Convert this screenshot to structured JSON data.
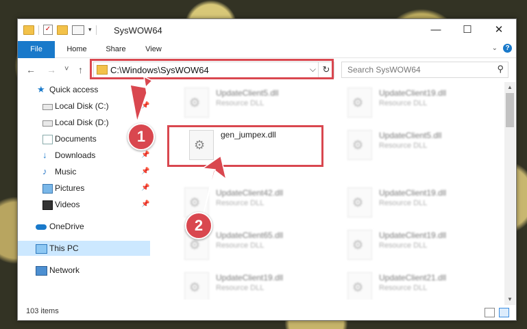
{
  "window": {
    "title": "SysWOW64",
    "minimize_glyph": "—",
    "maximize_glyph": "☐",
    "close_glyph": "✕"
  },
  "ribbon": {
    "tabs": [
      "File",
      "Home",
      "Share",
      "View"
    ]
  },
  "address": {
    "path": "C:\\Windows\\SysWOW64",
    "back_glyph": "←",
    "forward_glyph": "→",
    "recent_glyph": "˅",
    "up_glyph": "↑",
    "dropdown_glyph": "⌵",
    "refresh_glyph": "↻"
  },
  "search": {
    "placeholder": "Search SysWOW64"
  },
  "sidebar": {
    "items": [
      {
        "label": "Quick access",
        "icon": "star-icon"
      },
      {
        "label": "Local Disk (C:)",
        "icon": "drive-icon"
      },
      {
        "label": "Local Disk (D:)",
        "icon": "drive-icon"
      },
      {
        "label": "Documents",
        "icon": "documents-icon"
      },
      {
        "label": "Downloads",
        "icon": "download-icon"
      },
      {
        "label": "Music",
        "icon": "music-icon"
      },
      {
        "label": "Pictures",
        "icon": "pictures-icon"
      },
      {
        "label": "Videos",
        "icon": "videos-icon"
      },
      {
        "label": "OneDrive",
        "icon": "cloud-icon"
      },
      {
        "label": "This PC",
        "icon": "computer-icon",
        "selected": true
      },
      {
        "label": "Network",
        "icon": "network-icon"
      }
    ],
    "pin_glyph": "📌"
  },
  "files": [
    {
      "name": "UpdateClient5.dll",
      "type": "Resource DLL"
    },
    {
      "name": "UpdateClient19.dll",
      "type": "Resource DLL"
    },
    {
      "name": "gen_jumpex.dll",
      "type": ""
    },
    {
      "name": "UpdateClient5.dll",
      "type": "Resource DLL"
    },
    {
      "name": "UpdateClient42.dll",
      "type": "Resource DLL"
    },
    {
      "name": "UpdateClient19.dll",
      "type": "Resource DLL"
    },
    {
      "name": "UpdateClient65.dll",
      "type": "Resource DLL"
    },
    {
      "name": "UpdateClient19.dll",
      "type": "Resource DLL"
    },
    {
      "name": "UpdateClient19.dll",
      "type": "Resource DLL"
    },
    {
      "name": "UpdateClient21.dll",
      "type": "Resource DLL"
    }
  ],
  "status": {
    "item_count": "103 items"
  },
  "annotations": {
    "step1": "1",
    "step2": "2",
    "color": "#d9474f"
  }
}
